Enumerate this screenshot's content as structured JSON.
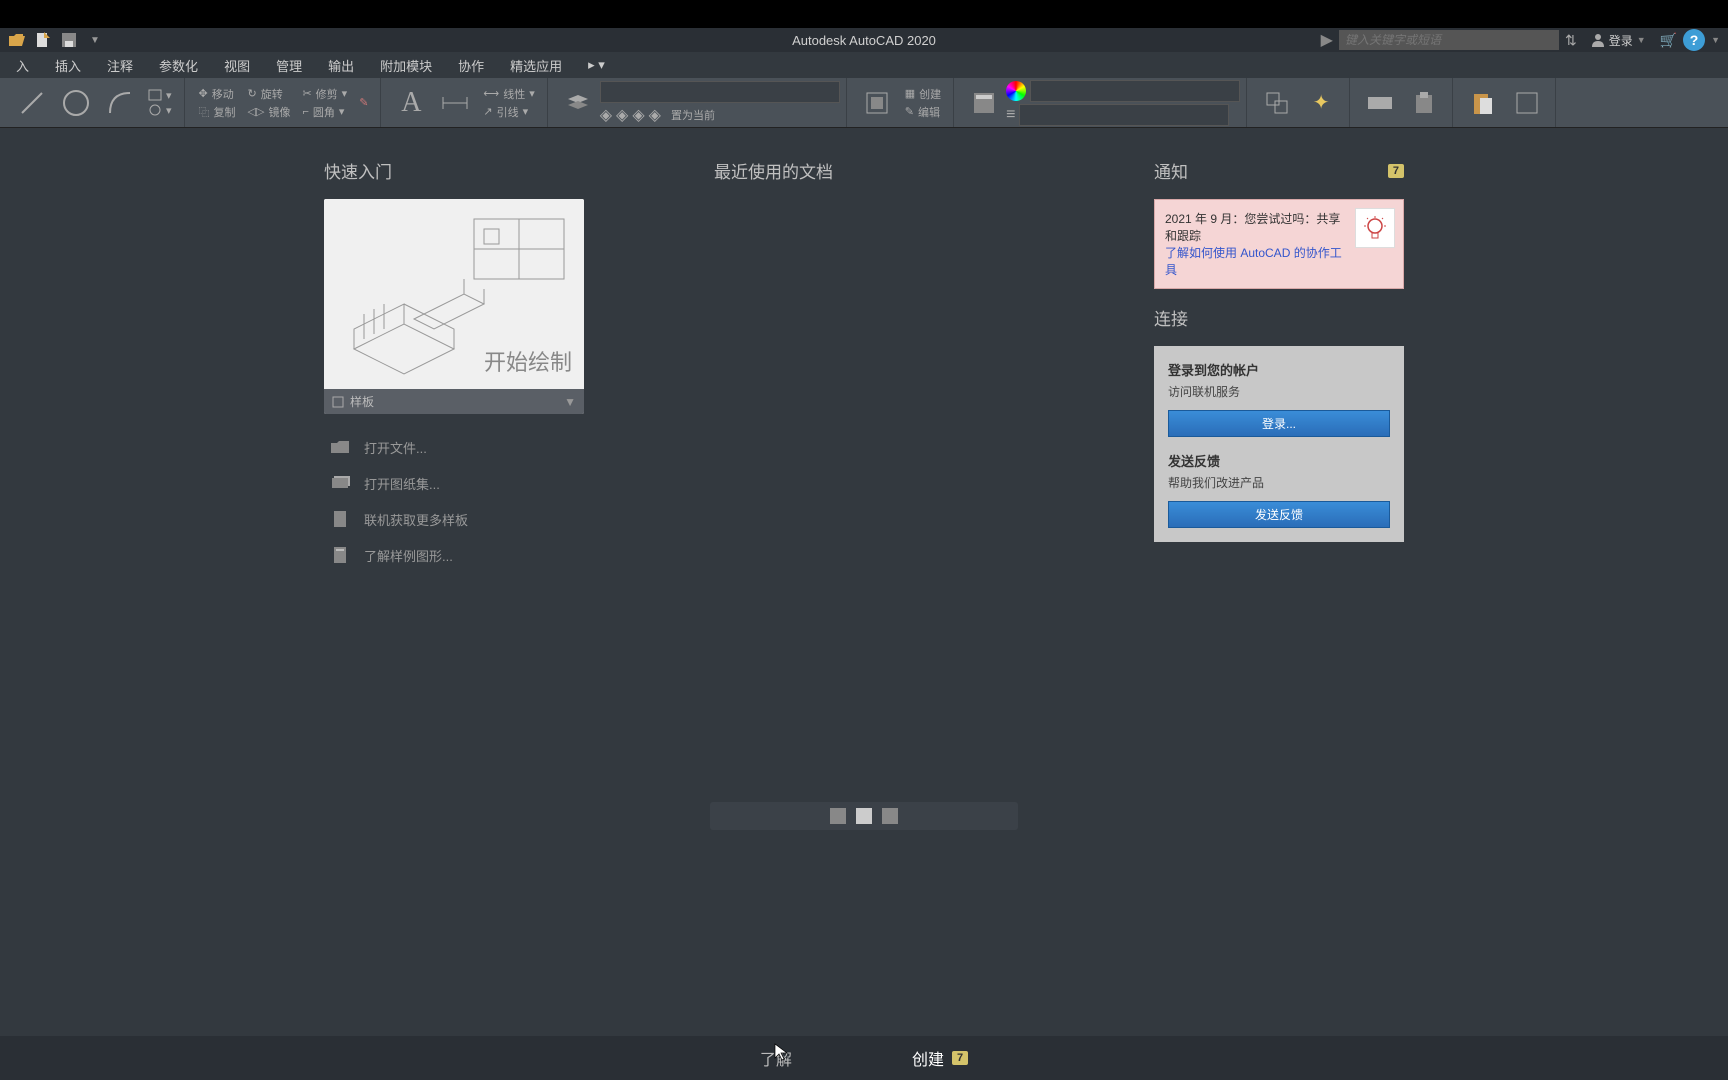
{
  "app_title": "Autodesk AutoCAD 2020",
  "search": {
    "placeholder": "键入关键字或短语"
  },
  "login_label": "登录",
  "menu": [
    "入",
    "插入",
    "注释",
    "参数化",
    "视图",
    "管理",
    "输出",
    "附加模块",
    "协作",
    "精选应用"
  ],
  "ribbon": {
    "move": "移动",
    "rotate": "旋转",
    "trim": "修剪",
    "copy": "复制",
    "mirror": "镜像",
    "fillet": "圆角",
    "linear": "线性",
    "leader": "引线",
    "set_current": "置为当前",
    "create": "创建",
    "edit": "编辑"
  },
  "sections": {
    "quickstart": "快速入门",
    "recent": "最近使用的文档",
    "notifications": "通知",
    "connect": "连接"
  },
  "start_card": {
    "text": "开始绘制",
    "footer": "样板"
  },
  "links": [
    "打开文件...",
    "打开图纸集...",
    "联机获取更多样板",
    "了解样例图形..."
  ],
  "notification": {
    "badge": "7",
    "text1": "2021 年 9 月：您尝试过吗：共享和跟踪",
    "link": "了解如何使用 AutoCAD 的协作工具"
  },
  "connect": {
    "login_title": "登录到您的帐户",
    "login_sub": "访问联机服务",
    "login_btn": "登录...",
    "feedback_title": "发送反馈",
    "feedback_sub": "帮助我们改进产品",
    "feedback_btn": "发送反馈"
  },
  "bottom_tabs": {
    "learn": "了解",
    "create": "创建",
    "create_badge": "7"
  }
}
